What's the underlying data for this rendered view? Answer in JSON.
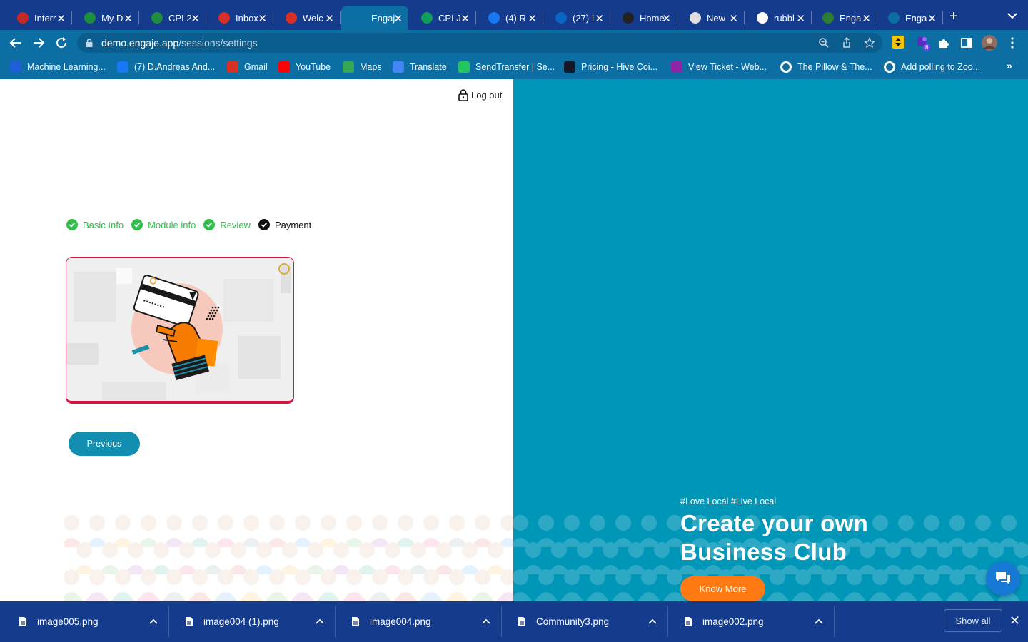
{
  "browser": {
    "tabs": [
      {
        "title": "Interr",
        "icon": "gauge-icon",
        "color": "#c62828"
      },
      {
        "title": "My D",
        "icon": "drive-icon",
        "color": "#1e8e3e"
      },
      {
        "title": "CPI 2",
        "icon": "drive-icon",
        "color": "#1e8e3e"
      },
      {
        "title": "Inbox",
        "icon": "gmail-icon",
        "color": "#d93025"
      },
      {
        "title": "Welc",
        "icon": "gmail-icon",
        "color": "#d93025"
      },
      {
        "title": "Engaj",
        "icon": "engaje-icon",
        "color": "#0c6ea3",
        "active": true
      },
      {
        "title": "CPI J",
        "icon": "sheets-icon",
        "color": "#0f9d58"
      },
      {
        "title": "(4) R",
        "icon": "facebook-icon",
        "color": "#1877f2"
      },
      {
        "title": "(27) I",
        "icon": "linkedin-icon",
        "color": "#0a66c2"
      },
      {
        "title": "Home",
        "icon": "web-icon",
        "color": "#222222"
      },
      {
        "title": "New",
        "icon": "chrome-icon",
        "color": "#e0e0e0"
      },
      {
        "title": "rubbl",
        "icon": "google-icon",
        "color": "#ffffff"
      },
      {
        "title": "Enga",
        "icon": "engaje-app-icon",
        "color": "#2e7d32"
      },
      {
        "title": "Enga",
        "icon": "engaje-icon",
        "color": "#0c6ea3"
      }
    ],
    "url_host": "demo.engaje.app",
    "url_path": "/sessions/settings",
    "extension_badge": "8",
    "bookmarks": [
      {
        "label": "Machine Learning...",
        "icon": "coursera-icon",
        "color": "#1f5fd6"
      },
      {
        "label": "(7) D.Andreas And...",
        "icon": "facebook-icon",
        "color": "#1877f2"
      },
      {
        "label": "Gmail",
        "icon": "gmail-icon",
        "color": "#d93025"
      },
      {
        "label": "YouTube",
        "icon": "youtube-icon",
        "color": "#ff0000"
      },
      {
        "label": "Maps",
        "icon": "maps-icon",
        "color": "#34a853"
      },
      {
        "label": "Translate",
        "icon": "translate-icon",
        "color": "#4285f4"
      },
      {
        "label": "SendTransfer | Se...",
        "icon": "sendtransfer-icon",
        "color": "#22c55e"
      },
      {
        "label": "Pricing - Hive Coi...",
        "icon": "hive-icon",
        "color": "#111827"
      },
      {
        "label": "View Ticket - Web...",
        "icon": "webi-icon",
        "color": "#8e24aa"
      },
      {
        "label": "The Pillow & The...",
        "icon": "globe-icon",
        "color": "#ffffff"
      },
      {
        "label": "Add polling to Zoo...",
        "icon": "globe-icon",
        "color": "#ffffff"
      }
    ]
  },
  "page": {
    "logout_label": "Log out",
    "steps": [
      {
        "label": "Basic Info",
        "status": "done"
      },
      {
        "label": "Module info",
        "status": "done"
      },
      {
        "label": "Review",
        "status": "done"
      },
      {
        "label": "Payment",
        "status": "current"
      }
    ],
    "previous_label": "Previous",
    "hero": {
      "tagline": "#Love Local #Live Local",
      "title_line1": "Create your own",
      "title_line2": "Business Club",
      "cta_label": "Know More"
    },
    "colors": {
      "panel": "#0096b8",
      "done": "#2fbf4a",
      "card_border": "#d6153f",
      "cta": "#ff7a12",
      "previous": "#128fb0"
    }
  },
  "downloads": {
    "items": [
      "image005.png",
      "image004 (1).png",
      "image004.png",
      "Community3.png",
      "image002.png"
    ],
    "show_all_label": "Show all"
  }
}
